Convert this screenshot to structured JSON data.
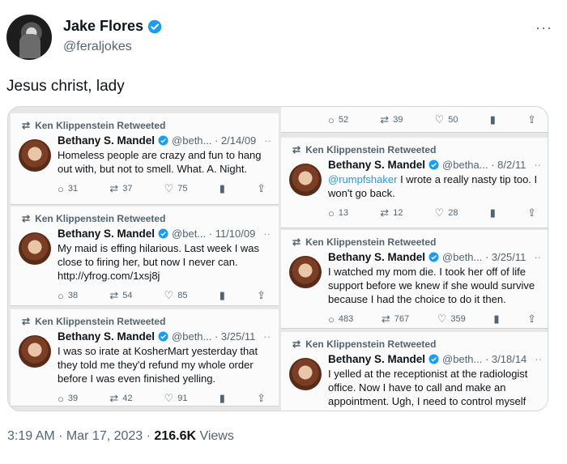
{
  "author": {
    "name": "Jake Flores",
    "handle": "@feraljokes"
  },
  "tweet_text": "Jesus christ, lady",
  "more_label": "···",
  "media": {
    "left": [
      {
        "retweeted_by": "Ken Klippenstein Retweeted",
        "name": "Bethany S. Mandel",
        "handle_date": "@beth... · 2/14/09",
        "text": "Homeless people are crazy and fun to hang out with, but not to smell. What. A. Night.",
        "replies": "31",
        "retweets": "37",
        "likes": "75"
      },
      {
        "retweeted_by": "Ken Klippenstein Retweeted",
        "name": "Bethany S. Mandel",
        "handle_date": "@bet... · 11/10/09",
        "text": "My maid is effing hilarious. Last week I was close to firing her, but now I never can. http://yfrog.com/1xsj8j",
        "replies": "38",
        "retweets": "54",
        "likes": "85"
      },
      {
        "retweeted_by": "Ken Klippenstein Retweeted",
        "name": "Bethany S. Mandel",
        "handle_date": "@beth... · 3/25/11",
        "text": "I was so irate at KosherMart yesterday that they told me they'd refund my whole order before I was even finished yelling.",
        "replies": "39",
        "retweets": "42",
        "likes": "91"
      }
    ],
    "right_top_actions": {
      "replies": "52",
      "retweets": "39",
      "likes": "50"
    },
    "right": [
      {
        "retweeted_by": "Ken Klippenstein Retweeted",
        "name": "Bethany S. Mandel",
        "handle_date": "@betha... · 8/2/11",
        "mention": "@rumpfshaker",
        "text": " I wrote a really nasty tip too. I won't go back.",
        "replies": "13",
        "retweets": "12",
        "likes": "28"
      },
      {
        "retweeted_by": "Ken Klippenstein Retweeted",
        "name": "Bethany S. Mandel",
        "handle_date": "@beth... · 3/25/11",
        "text": "I watched my mom die. I took her off of life support before we knew if she would survive because I had the choice to do it then.",
        "replies": "483",
        "retweets": "767",
        "likes": "359"
      },
      {
        "retweeted_by": "Ken Klippenstein Retweeted",
        "name": "Bethany S. Mandel",
        "handle_date": "@beth... · 3/18/14",
        "text": "I yelled at the receptionist at the radiologist office. Now I have to call and make an appointment. Ugh, I need to control myself better"
      }
    ]
  },
  "footer": {
    "time": "3:19 AM · Mar 17, 2023 · ",
    "views_count": "216.6K",
    "views_label": " Views"
  },
  "icons": {
    "reply": "reply-icon",
    "retweet": "retweet-icon",
    "like": "heart-icon",
    "stats": "stats-icon",
    "share": "share-icon",
    "verified": "verified-badge-icon"
  },
  "colors": {
    "verified": "#1d9bf0",
    "muted": "#536471",
    "link": "#1d9bf0"
  }
}
